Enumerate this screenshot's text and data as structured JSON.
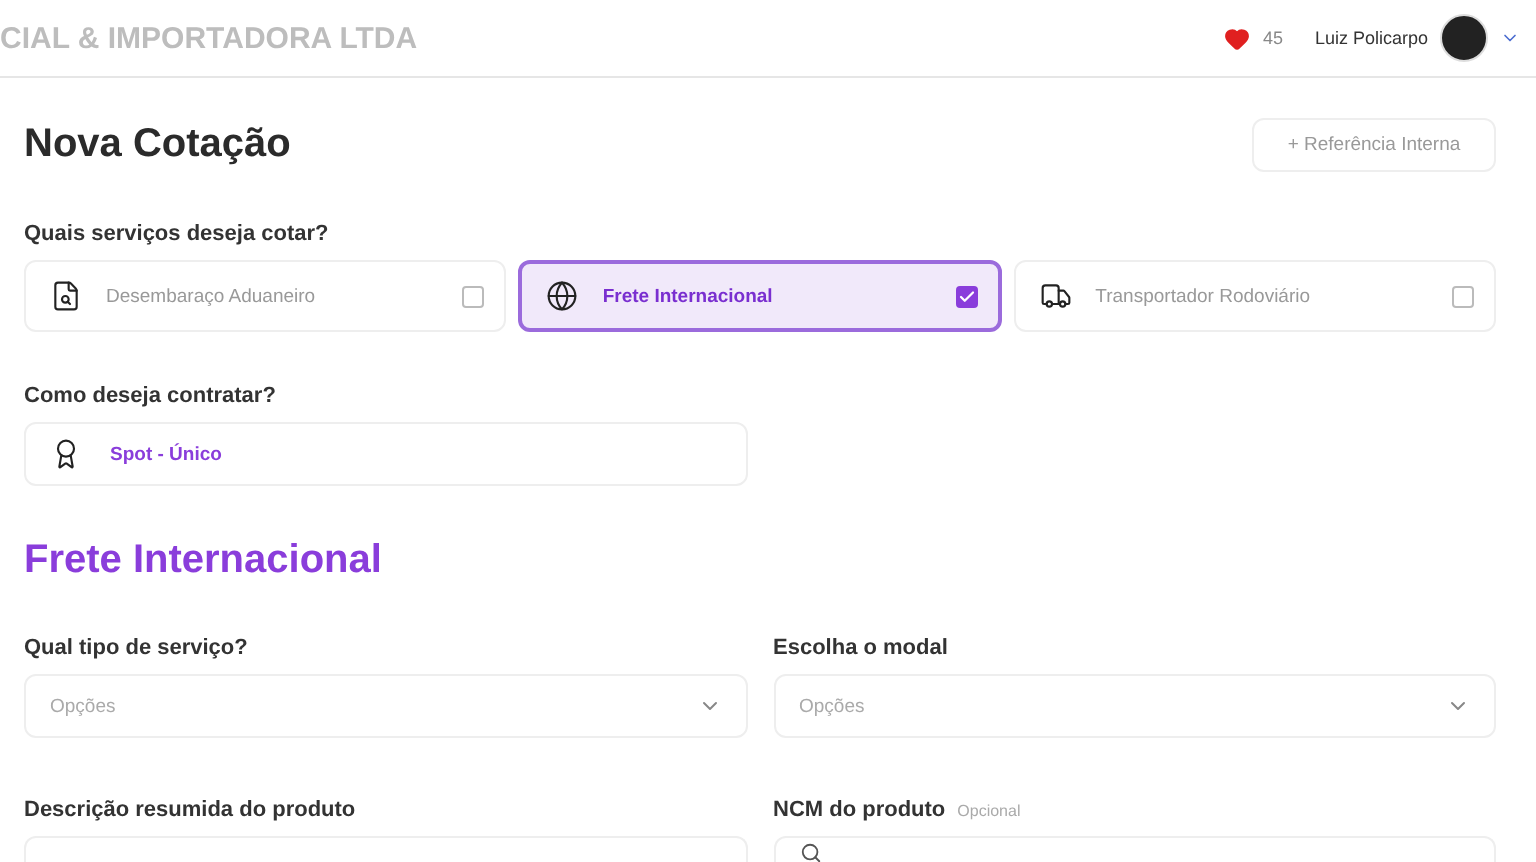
{
  "header": {
    "company": "CIAL & IMPORTADORA LTDA",
    "badge_count": "45",
    "user_name": "Luiz Policarpo"
  },
  "page": {
    "title": "Nova Cotação",
    "reference_button": "+ Referência Interna"
  },
  "services": {
    "label": "Quais serviços deseja cotar?",
    "options": [
      {
        "kind": "document",
        "label": "Desembaraço Aduaneiro",
        "checked": false
      },
      {
        "kind": "globe",
        "label": "Frete Internacional",
        "checked": true
      },
      {
        "kind": "truck",
        "label": "Transportador Rodoviário",
        "checked": false
      }
    ]
  },
  "contract": {
    "label": "Como deseja contratar?",
    "value": "Spot - Único"
  },
  "section": {
    "title": "Frete Internacional",
    "fields": [
      {
        "kind": "select",
        "label": "Qual tipo de serviço?",
        "placeholder": "Opções"
      },
      {
        "kind": "select",
        "label": "Escolha o modal",
        "placeholder": "Opções"
      },
      {
        "kind": "text",
        "label": "Descrição resumida do produto"
      },
      {
        "kind": "search",
        "label": "NCM do produto",
        "hint": "Opcional"
      }
    ]
  }
}
